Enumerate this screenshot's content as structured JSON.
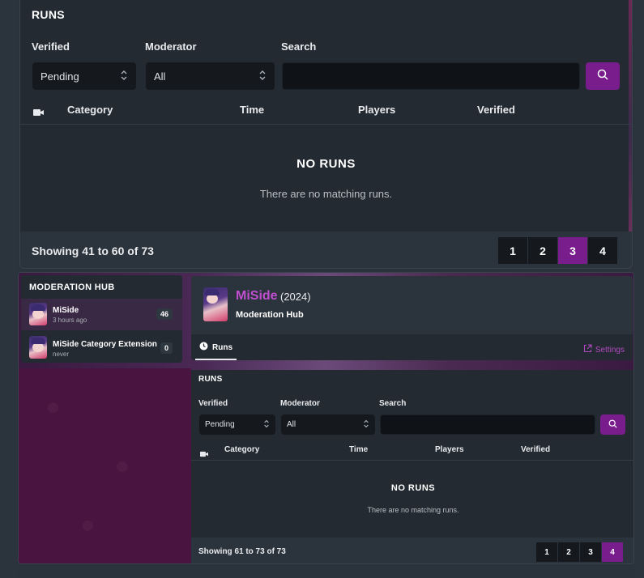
{
  "top_panel": {
    "title": "RUNS",
    "filters": {
      "verified_label": "Verified",
      "verified_value": "Pending",
      "moderator_label": "Moderator",
      "moderator_value": "All",
      "search_label": "Search",
      "search_placeholder": ""
    },
    "columns": [
      "Category",
      "Time",
      "Players",
      "Verified"
    ],
    "empty_title": "NO RUNS",
    "empty_subtitle": "There are no matching runs.",
    "showing": "Showing 41 to 60 of 73",
    "pages": [
      "1",
      "2",
      "3",
      "4"
    ],
    "active_page": "3"
  },
  "moderation_hub": {
    "title": "MODERATION HUB",
    "items": [
      {
        "name": "MiSide",
        "time": "3 hours ago",
        "count": "46",
        "active": true
      },
      {
        "name": "MiSide Category Extension",
        "time": "never",
        "count": "0",
        "active": false
      }
    ]
  },
  "game": {
    "name": "MiSide",
    "year": "(2024)",
    "subtitle": "Moderation Hub",
    "tab_label": "Runs",
    "settings_label": "Settings"
  },
  "bottom_panel": {
    "title": "RUNS",
    "filters": {
      "verified_label": "Verified",
      "verified_value": "Pending",
      "moderator_label": "Moderator",
      "moderator_value": "All",
      "search_label": "Search",
      "search_placeholder": ""
    },
    "columns": [
      "Category",
      "Time",
      "Players",
      "Verified"
    ],
    "empty_title": "NO RUNS",
    "empty_subtitle": "There are no matching runs.",
    "showing": "Showing 61 to 73 of 73",
    "pages": [
      "1",
      "2",
      "3",
      "4"
    ],
    "active_page": "4"
  },
  "colors": {
    "accent": "#7a1d8c",
    "link": "#b24ac2",
    "panel": "#232a31",
    "background": "#2a323b"
  },
  "icons": {
    "camera": "video-camera-icon",
    "search": "search-icon",
    "chevron": "chevron-up-down-icon",
    "clock": "clock-icon",
    "external": "external-link-icon"
  }
}
